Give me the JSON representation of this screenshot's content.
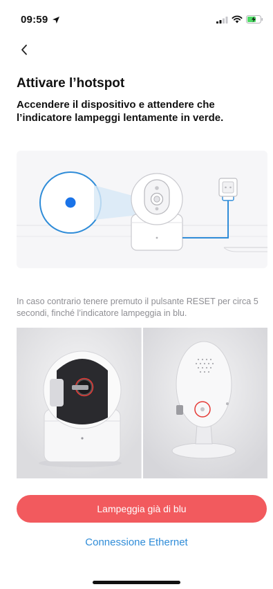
{
  "status_bar": {
    "time": "09:59",
    "icons": [
      "location-arrow-icon",
      "signal-icon",
      "wifi-icon",
      "battery-charging-icon"
    ],
    "battery_color": "#4cd964"
  },
  "nav": {
    "back_icon": "chevron-left-icon"
  },
  "content": {
    "title": "Attivare l’hotspot",
    "subtitle": "Accendere il dispositivo e attendere che l’indicatore lampeggi lentamente in verde.",
    "hint": "In caso contrario tenere premuto il pulsante RESET per circa 5 secondi, finché l’indicatore lampeggia in blu."
  },
  "illustration": {
    "icons": [
      "indicator-light-icon",
      "camera-icon",
      "power-outlet-icon"
    ],
    "indicator_color": "#1a73e8",
    "accent_color": "#2f8cd8"
  },
  "actions": {
    "primary_label": "Lampeggia già di blu",
    "primary_color": "#f25a5e",
    "secondary_label": "Connessione Ethernet",
    "secondary_color": "#2f8cd8"
  }
}
